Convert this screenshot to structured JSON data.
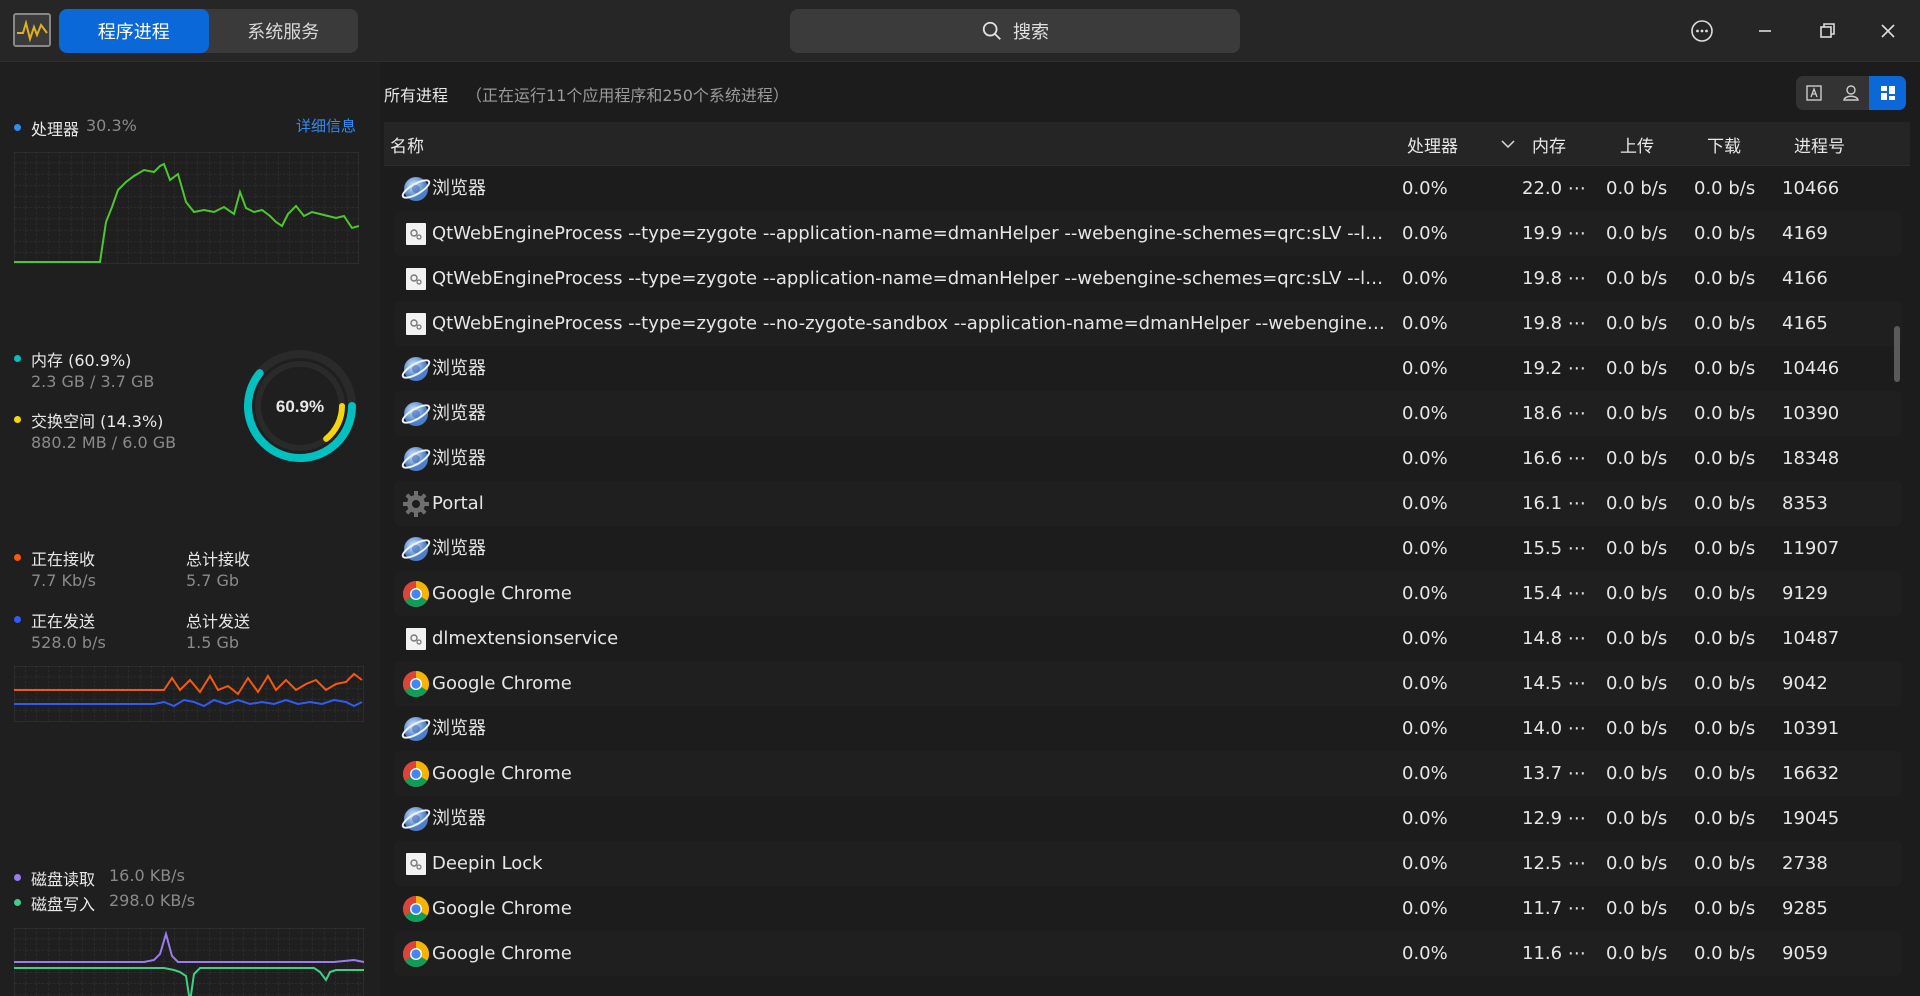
{
  "titlebar": {
    "tabs": [
      {
        "label": "程序进程",
        "active": true
      },
      {
        "label": "系统服务",
        "active": false
      }
    ],
    "search_label": "搜索",
    "buttons": [
      "menu-icon",
      "minimize-icon",
      "maximize-icon",
      "close-icon"
    ]
  },
  "sidebar": {
    "cpu": {
      "label": "处理器",
      "value": "30.3%",
      "details_link": "详细信息",
      "color": "#2f8cf5",
      "graph_color": "#4ec72a"
    },
    "memory": {
      "label": "内存 (60.9%)",
      "detail": "2.3 GB / 3.7 GB",
      "color": "#00c0c0",
      "percent_text": "60.9%",
      "memory_fraction": 0.609
    },
    "swap": {
      "label": "交换空间 (14.3%)",
      "detail": "880.2 MB / 6.0 GB",
      "color": "#f5d60a",
      "swap_fraction": 0.143
    },
    "network": {
      "receiving_label": "正在接收",
      "receiving_value": "7.7 Kb/s",
      "total_receive_label": "总计接收",
      "total_receive_value": "5.7 Gb",
      "sending_label": "正在发送",
      "sending_value": "528.0 b/s",
      "total_send_label": "总计发送",
      "total_send_value": "1.5 Gb",
      "receive_color": "#f55a0a",
      "send_color": "#2f5cf5"
    },
    "disk": {
      "read_label": "磁盘读取",
      "read_value": "16.0 KB/s",
      "write_label": "磁盘写入",
      "write_value": "298.0 KB/s",
      "read_color": "#9b7cf0",
      "write_color": "#3ed08a"
    }
  },
  "main": {
    "title": "所有进程",
    "hint": "（正在运行11个应用程序和250个系统进程）",
    "view_buttons": [
      "app-view-icon",
      "user-view-icon",
      "all-view-icon"
    ],
    "columns": {
      "name": "名称",
      "cpu": "处理器",
      "memory": "内存",
      "upload": "上传",
      "download": "下载",
      "pid": "进程号"
    },
    "rows": [
      {
        "icon": "browser",
        "name": "浏览器",
        "cpu": "0.0%",
        "mem": "22.0 ⋯",
        "up": "0.0 b/s",
        "down": "0.0 b/s",
        "pid": "10466"
      },
      {
        "icon": "generic",
        "name": "QtWebEngineProcess --type=zygote --application-name=dmanHelper --webengine-schemes=qrc:sLV --lang=zh",
        "cpu": "0.0%",
        "mem": "19.9 ⋯",
        "up": "0.0 b/s",
        "down": "0.0 b/s",
        "pid": "4169"
      },
      {
        "icon": "generic",
        "name": "QtWebEngineProcess --type=zygote --application-name=dmanHelper --webengine-schemes=qrc:sLV --lang=zh",
        "cpu": "0.0%",
        "mem": "19.8 ⋯",
        "up": "0.0 b/s",
        "down": "0.0 b/s",
        "pid": "4166"
      },
      {
        "icon": "generic",
        "name": "QtWebEngineProcess --type=zygote --no-zygote-sandbox --application-name=dmanHelper --webengine-schemes⋯",
        "cpu": "0.0%",
        "mem": "19.8 ⋯",
        "up": "0.0 b/s",
        "down": "0.0 b/s",
        "pid": "4165"
      },
      {
        "icon": "browser",
        "name": "浏览器",
        "cpu": "0.0%",
        "mem": "19.2 ⋯",
        "up": "0.0 b/s",
        "down": "0.0 b/s",
        "pid": "10446"
      },
      {
        "icon": "browser",
        "name": "浏览器",
        "cpu": "0.0%",
        "mem": "18.6 ⋯",
        "up": "0.0 b/s",
        "down": "0.0 b/s",
        "pid": "10390"
      },
      {
        "icon": "browser",
        "name": "浏览器",
        "cpu": "0.0%",
        "mem": "16.6 ⋯",
        "up": "0.0 b/s",
        "down": "0.0 b/s",
        "pid": "18348"
      },
      {
        "icon": "gear",
        "name": "Portal",
        "cpu": "0.0%",
        "mem": "16.1 ⋯",
        "up": "0.0 b/s",
        "down": "0.0 b/s",
        "pid": "8353"
      },
      {
        "icon": "browser",
        "name": "浏览器",
        "cpu": "0.0%",
        "mem": "15.5 ⋯",
        "up": "0.0 b/s",
        "down": "0.0 b/s",
        "pid": "11907"
      },
      {
        "icon": "chrome",
        "name": "Google Chrome",
        "cpu": "0.0%",
        "mem": "15.4 ⋯",
        "up": "0.0 b/s",
        "down": "0.0 b/s",
        "pid": "9129"
      },
      {
        "icon": "generic",
        "name": "dlmextensionservice",
        "cpu": "0.0%",
        "mem": "14.8 ⋯",
        "up": "0.0 b/s",
        "down": "0.0 b/s",
        "pid": "10487"
      },
      {
        "icon": "chrome",
        "name": "Google Chrome",
        "cpu": "0.0%",
        "mem": "14.5 ⋯",
        "up": "0.0 b/s",
        "down": "0.0 b/s",
        "pid": "9042"
      },
      {
        "icon": "browser",
        "name": "浏览器",
        "cpu": "0.0%",
        "mem": "14.0 ⋯",
        "up": "0.0 b/s",
        "down": "0.0 b/s",
        "pid": "10391"
      },
      {
        "icon": "chrome",
        "name": "Google Chrome",
        "cpu": "0.0%",
        "mem": "13.7 ⋯",
        "up": "0.0 b/s",
        "down": "0.0 b/s",
        "pid": "16632"
      },
      {
        "icon": "browser",
        "name": "浏览器",
        "cpu": "0.0%",
        "mem": "12.9 ⋯",
        "up": "0.0 b/s",
        "down": "0.0 b/s",
        "pid": "19045"
      },
      {
        "icon": "generic",
        "name": "Deepin Lock",
        "cpu": "0.0%",
        "mem": "12.5 ⋯",
        "up": "0.0 b/s",
        "down": "0.0 b/s",
        "pid": "2738"
      },
      {
        "icon": "chrome",
        "name": "Google Chrome",
        "cpu": "0.0%",
        "mem": "11.7 ⋯",
        "up": "0.0 b/s",
        "down": "0.0 b/s",
        "pid": "9285"
      },
      {
        "icon": "chrome",
        "name": "Google Chrome",
        "cpu": "0.0%",
        "mem": "11.6 ⋯",
        "up": "0.0 b/s",
        "down": "0.0 b/s",
        "pid": "9059"
      }
    ]
  }
}
